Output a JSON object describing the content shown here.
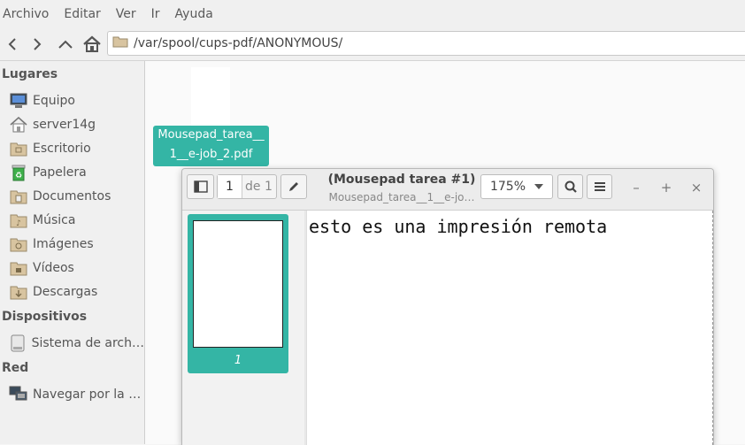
{
  "menu": {
    "file": "Archivo",
    "edit": "Editar",
    "view": "Ver",
    "go": "Ir",
    "help": "Ayuda"
  },
  "location": {
    "path": "/var/spool/cups-pdf/ANONYMOUS/"
  },
  "sidebar": {
    "places_title": "Lugares",
    "places": [
      {
        "label": "Equipo",
        "icon": "computer-icon"
      },
      {
        "label": "server14g",
        "icon": "home-icon"
      },
      {
        "label": "Escritorio",
        "icon": "desktop-folder-icon"
      },
      {
        "label": "Papelera",
        "icon": "trash-icon"
      },
      {
        "label": "Documentos",
        "icon": "documents-folder-icon"
      },
      {
        "label": "Música",
        "icon": "music-folder-icon"
      },
      {
        "label": "Imágenes",
        "icon": "pictures-folder-icon"
      },
      {
        "label": "Vídeos",
        "icon": "videos-folder-icon"
      },
      {
        "label": "Descargas",
        "icon": "downloads-folder-icon"
      }
    ],
    "devices_title": "Dispositivos",
    "devices": [
      {
        "label": "Sistema de arch…",
        "icon": "drive-icon"
      }
    ],
    "network_title": "Red",
    "network": [
      {
        "label": "Navegar por la …",
        "icon": "network-icon"
      }
    ]
  },
  "files": [
    {
      "name_line1": "Mousepad_tarea__",
      "name_line2": "1__e-job_2.pdf"
    }
  ],
  "viewer": {
    "page_current": "1",
    "page_total": "de 1",
    "title": "(Mousepad tarea #1)",
    "subtitle": "Mousepad_tarea__1__e-jo…",
    "zoom": "175%",
    "thumb_page_label": "1",
    "document_text": "esto es una impresión remota",
    "accent_color": "#34b5a5"
  }
}
